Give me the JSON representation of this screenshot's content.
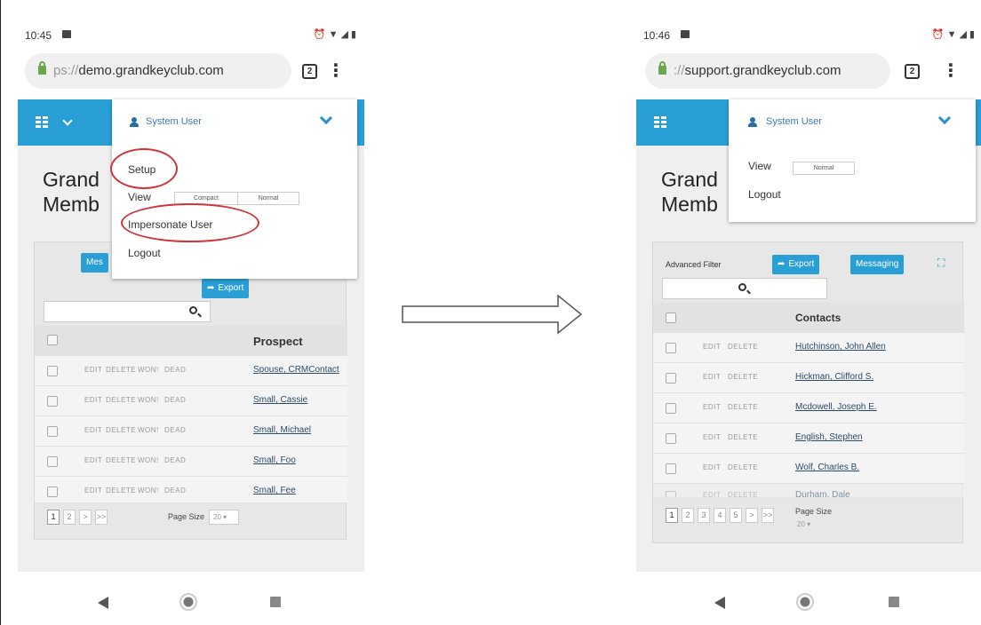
{
  "left": {
    "status": {
      "time": "10:45"
    },
    "url": {
      "prefix": "ps://",
      "host": "demo.grandkeyclub.com"
    },
    "tab_count": "2",
    "page_title": [
      "Grand",
      "Memb"
    ],
    "menu": {
      "user": "System User",
      "items": {
        "setup": "Setup",
        "view": "View",
        "impersonate": "Impersonate User",
        "logout": "Logout"
      },
      "view_options": [
        "Compact",
        "Normal"
      ]
    },
    "buttons": {
      "messaging_partial": "Mes",
      "export": "Export"
    },
    "table": {
      "header": "Prospect",
      "actions": [
        "EDIT",
        "DELETE",
        "WON!",
        "DEAD"
      ],
      "rows": [
        "Spouse, CRMContact",
        "Small, Cassie",
        "Small, Michael",
        "Small, Foo",
        "Small, Fee"
      ]
    },
    "pager": {
      "pages": [
        "1",
        "2",
        ">",
        ">>"
      ],
      "page_size_label": "Page Size",
      "page_size_value": "20"
    }
  },
  "right": {
    "status": {
      "time": "10:46"
    },
    "url": {
      "prefix": "://",
      "host": "support.grandkeyclub.com"
    },
    "tab_count": "2",
    "page_title": [
      "Grand",
      "Memb"
    ],
    "menu": {
      "user": "System User",
      "items": {
        "view": "View",
        "logout": "Logout"
      },
      "view_options": [
        "Normal"
      ]
    },
    "buttons": {
      "advanced_filter": "Advanced Filter",
      "export": "Export",
      "messaging": "Messaging"
    },
    "table": {
      "header": "Contacts",
      "actions": [
        "EDIT",
        "DELETE"
      ],
      "rows": [
        "Hutchinson, John Allen",
        "Hickman, Clifford S.",
        "Mcdowell, Joseph E.",
        "English, Stephen",
        "Wolf, Charles B.",
        "Durham, Dale"
      ]
    },
    "pager": {
      "pages": [
        "1",
        "2",
        "3",
        "4",
        "5",
        ">",
        ">>"
      ],
      "page_size_label": "Page Size",
      "page_size_value": "20"
    }
  },
  "colors": {
    "accent": "#2a9fd6",
    "highlight_circle": "#d0343a"
  }
}
